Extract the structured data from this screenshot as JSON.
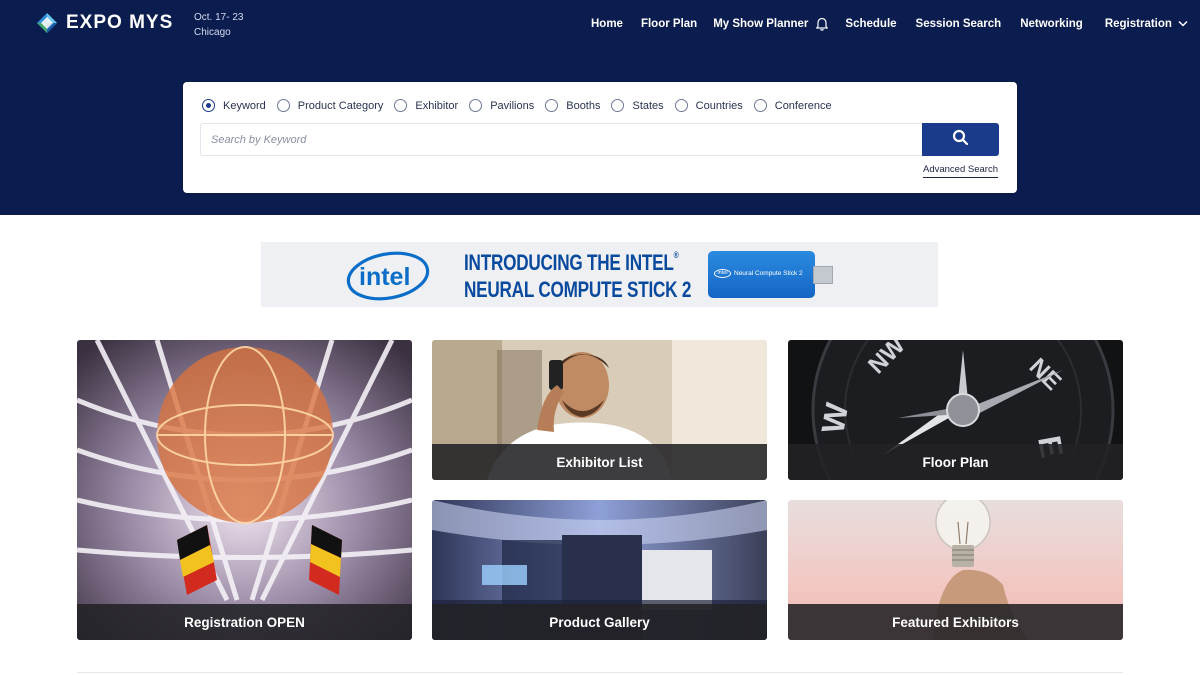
{
  "brand": {
    "name": "EXPO MYS",
    "dates": "Oct. 17- 23",
    "city": "Chicago"
  },
  "nav": {
    "home": "Home",
    "floor_plan": "Floor Plan",
    "show_planner": "My Show Planner",
    "schedule": "Schedule",
    "session_search": "Session Search",
    "networking": "Networking",
    "registration": "Registration"
  },
  "search": {
    "options": [
      "Keyword",
      "Product Category",
      "Exhibitor",
      "Pavilions",
      "Booths",
      "States",
      "Countries",
      "Conference"
    ],
    "selected": "Keyword",
    "placeholder": "Search by Keyword",
    "value": "",
    "advanced_label": "Advanced Search"
  },
  "banner": {
    "brand": "intel",
    "line1": "INTRODUCING THE INTEL",
    "line1_mark": "®",
    "line2": "NEURAL COMPUTE STICK 2",
    "product_brand": "intel",
    "product_label": "Neural Compute Stick 2"
  },
  "tiles": {
    "registration": "Registration OPEN",
    "exhibitor_list": "Exhibitor List",
    "floor_plan": "Floor Plan",
    "product_gallery": "Product Gallery",
    "featured_exhibitors": "Featured Exhibitors"
  },
  "colors": {
    "header_bg": "#0b1d4f",
    "accent": "#1a3a8c",
    "banner_blue": "#0a4a9e"
  },
  "icons": {
    "logo": "diamond-logo-icon",
    "bell": "bell-icon",
    "chevron": "chevron-down-icon",
    "search": "search-icon"
  }
}
